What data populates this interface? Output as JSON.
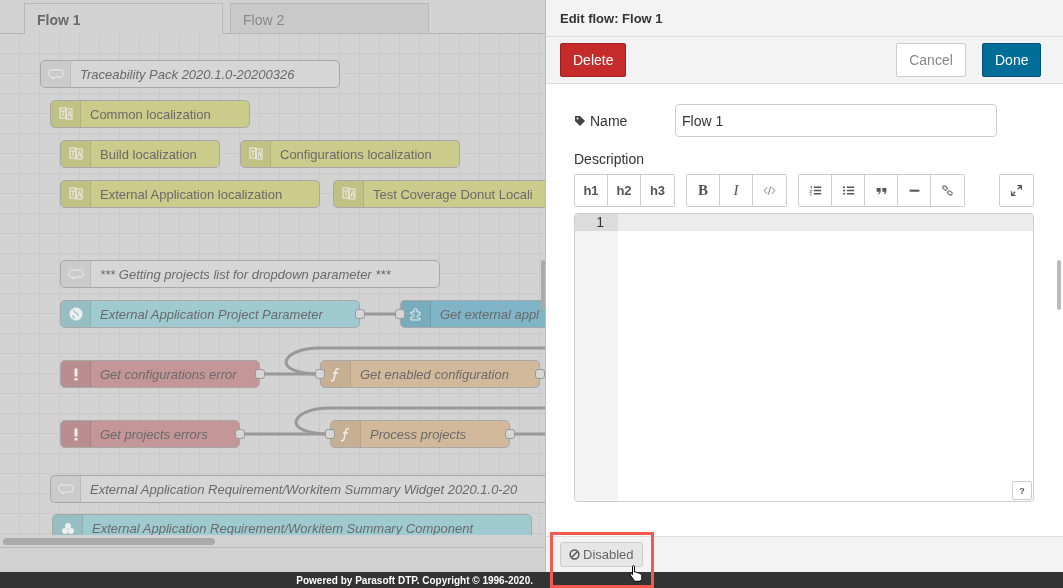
{
  "tabs": [
    {
      "label": "Flow 1",
      "selected": true
    },
    {
      "label": "Flow 2",
      "selected": false
    }
  ],
  "nodes": [
    {
      "kind": "comment",
      "label": "Traceability Pack 2020.1.0-20200326"
    },
    {
      "kind": "localization",
      "label": "Common localization"
    },
    {
      "kind": "localization",
      "label": "Build localization"
    },
    {
      "kind": "localization",
      "label": "Configurations localization"
    },
    {
      "kind": "localization",
      "label": "External Application localization"
    },
    {
      "kind": "localization",
      "label": "Test Coverage Donut Locali"
    },
    {
      "kind": "comment",
      "label": "*** Getting projects list for dropdown parameter ***"
    },
    {
      "kind": "inject",
      "label": "External Application Project Parameter"
    },
    {
      "kind": "subflow",
      "label": "Get external appl"
    },
    {
      "kind": "catch",
      "label": "Get configurations error"
    },
    {
      "kind": "function",
      "label": "Get enabled configuration"
    },
    {
      "kind": "catch",
      "label": "Get projects errors"
    },
    {
      "kind": "function",
      "label": "Process projects"
    },
    {
      "kind": "comment",
      "label": "External Application Requirement/Workitem Summary Widget 2020.1.0-20"
    },
    {
      "kind": "component",
      "label": "External Application Requirement/Workitem Summary Component"
    }
  ],
  "footer": "Powered by Parasoft DTP. Copyright © 1996-2020.",
  "editor": {
    "title": "Edit flow: Flow 1",
    "buttons": [
      {
        "kind": "danger",
        "label": "Delete"
      },
      {
        "kind": "plain",
        "label": "Cancel"
      },
      {
        "kind": "primary",
        "label": "Done"
      }
    ],
    "name_label": "Name",
    "name_value": "Flow 1",
    "description_label": "Description",
    "toolbar": [
      [
        {
          "kind": "text",
          "label": "h1"
        },
        {
          "kind": "text",
          "label": "h2"
        },
        {
          "kind": "text",
          "label": "h3"
        }
      ],
      [
        {
          "kind": "serif",
          "label": "B"
        },
        {
          "kind": "serif-italic",
          "label": "I"
        },
        {
          "kind": "code"
        }
      ],
      [
        {
          "kind": "ordered-list"
        },
        {
          "kind": "bullet-list"
        },
        {
          "kind": "quote"
        },
        {
          "kind": "rule"
        },
        {
          "kind": "link"
        }
      ],
      [
        {
          "kind": "expand"
        }
      ]
    ],
    "line_numbers": [
      "1"
    ],
    "help": "?",
    "status_button": "Disabled"
  }
}
